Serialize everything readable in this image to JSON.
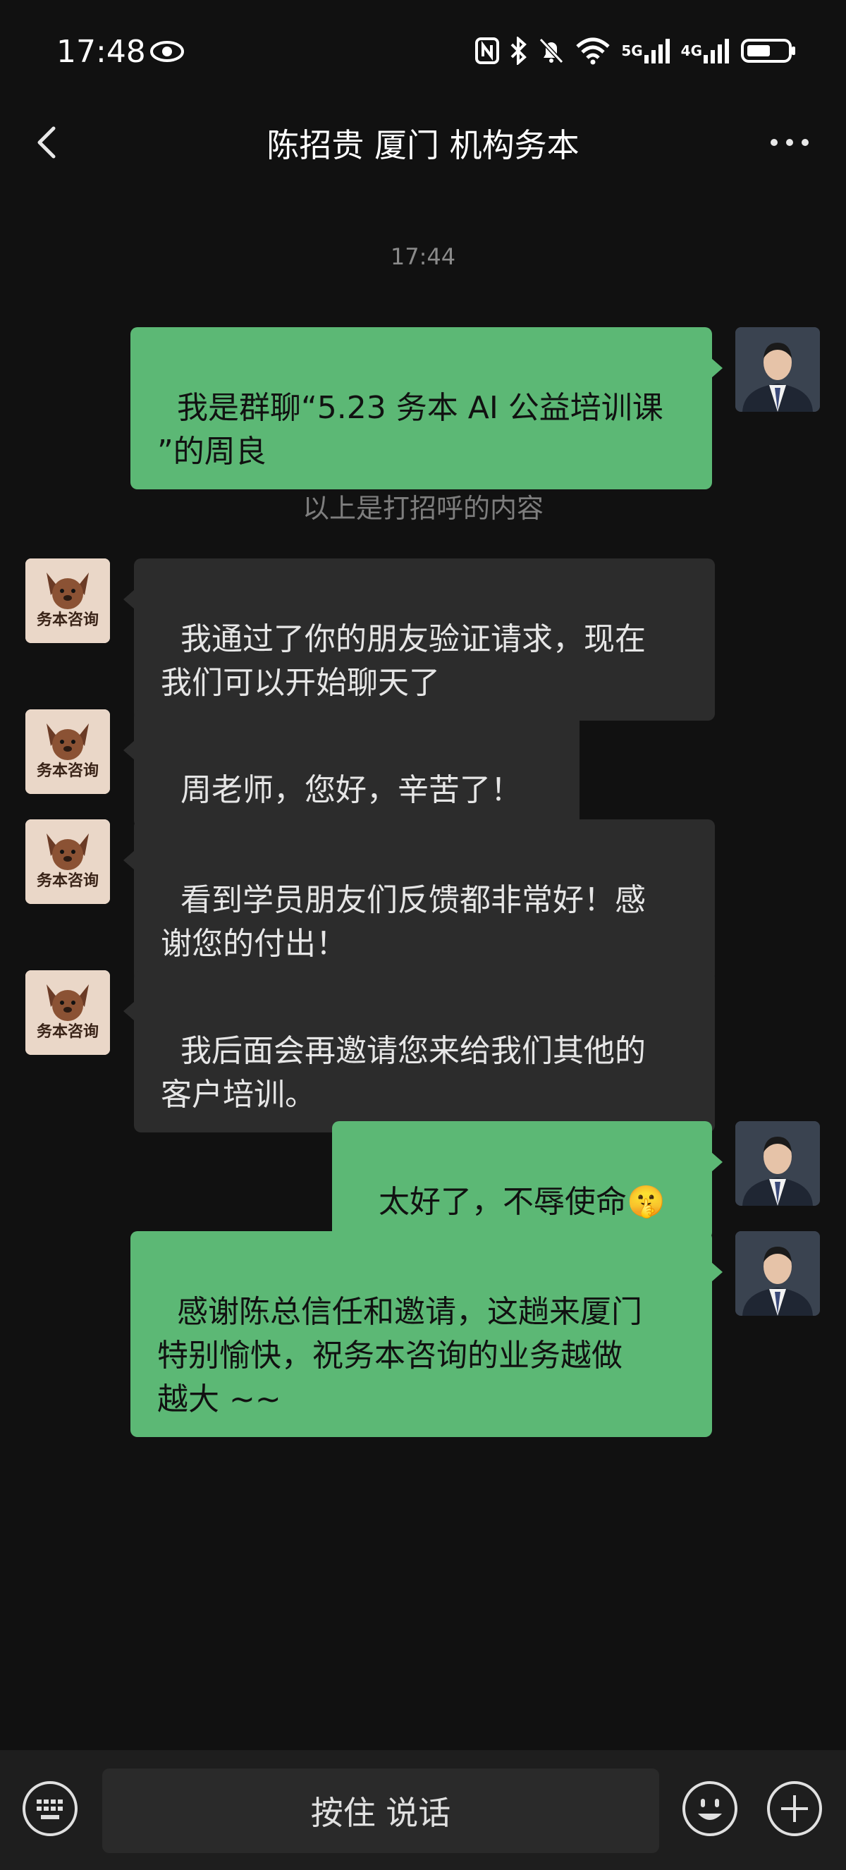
{
  "status_bar": {
    "time": "17:48",
    "net1": "5G",
    "net2": "4G"
  },
  "nav": {
    "title": "陈招贵 厦门 机构务本"
  },
  "chat": {
    "timestamp": "17:44",
    "system_note": "以上是打招呼的内容",
    "messages": [
      {
        "from": "me",
        "text": "我是群聊“5.23 务本 AI 公益培训课\n”的周良"
      },
      {
        "from": "them",
        "text": "我通过了你的朋友验证请求，现在\n我们可以开始聊天了"
      },
      {
        "from": "them",
        "text": "周老师，您好，辛苦了！"
      },
      {
        "from": "them",
        "text": "看到学员朋友们反馈都非常好！感\n谢您的付出！"
      },
      {
        "from": "them",
        "text": "我后面会再邀请您来给我们其他的\n客户培训。"
      },
      {
        "from": "me",
        "text": "太好了，不辱使命",
        "emoji": "🤫"
      },
      {
        "from": "me",
        "text": "感谢陈总信任和邀请，这趟来厦门\n特别愉快，祝务本咨询的业务越做\n越大 ~~"
      }
    ],
    "contact_avatar_text": "务本咨询"
  },
  "input_bar": {
    "voice_label": "按住 说话"
  },
  "colors": {
    "my_bubble": "#5cb875",
    "their_bubble": "#2c2c2c",
    "background": "#111111"
  }
}
